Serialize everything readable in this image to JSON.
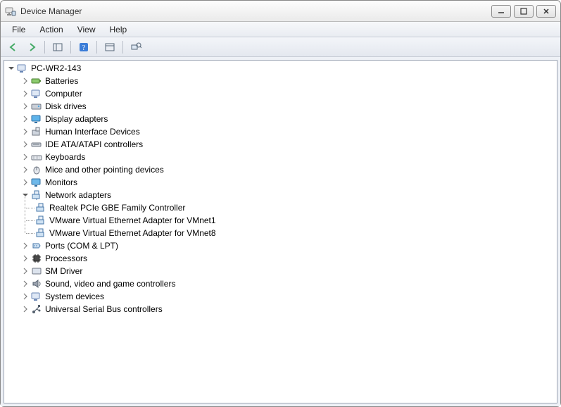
{
  "window": {
    "title": "Device Manager"
  },
  "menu": {
    "file": "File",
    "action": "Action",
    "view": "View",
    "help": "Help"
  },
  "root": {
    "name": "PC-WR2-143"
  },
  "cats": {
    "batteries": "Batteries",
    "computer": "Computer",
    "diskdrives": "Disk drives",
    "display": "Display adapters",
    "hid": "Human Interface Devices",
    "ide": "IDE ATA/ATAPI controllers",
    "keyboards": "Keyboards",
    "mice": "Mice and other pointing devices",
    "monitors": "Monitors",
    "network": "Network adapters",
    "ports": "Ports (COM & LPT)",
    "processors": "Processors",
    "smdriver": "SM Driver",
    "sound": "Sound, video and game controllers",
    "system": "System devices",
    "usb": "Universal Serial Bus controllers"
  },
  "network_children": {
    "0": "Realtek PCIe GBE Family Controller",
    "1": "VMware Virtual Ethernet Adapter for VMnet1",
    "2": "VMware Virtual Ethernet Adapter for VMnet8"
  }
}
